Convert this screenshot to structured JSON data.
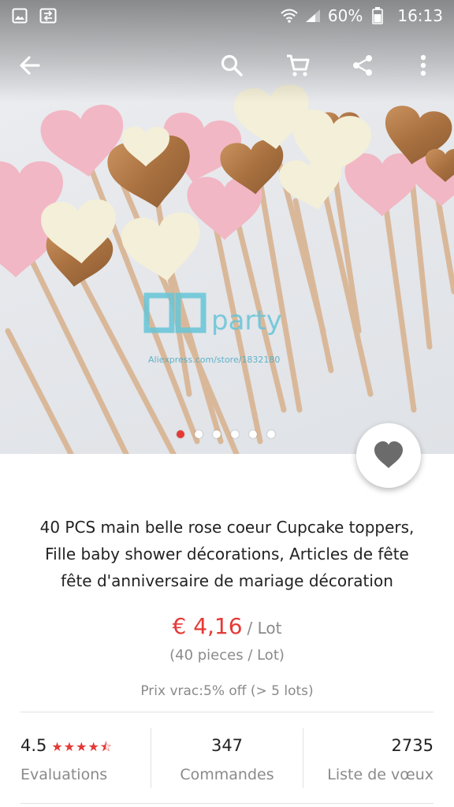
{
  "status_bar": {
    "battery_text": "60%",
    "time": "16:13"
  },
  "icons": {
    "back": "arrow-left-icon",
    "search": "search-icon",
    "cart": "cart-icon",
    "share": "share-icon",
    "more": "more-vertical-icon",
    "favorite": "heart-icon"
  },
  "product_image": {
    "watermark_brand": "party",
    "watermark_url": "Aliexpress.com/store/1832180",
    "slide_count": 6,
    "active_slide": 1
  },
  "product": {
    "title_lines": [
      "40 PCS main belle rose coeur Cupcake toppers,",
      "Fille baby shower décorations, Articles de fête",
      "fête d'anniversaire de mariage décoration"
    ],
    "price": "€ 4,16",
    "price_unit": "/ Lot",
    "pieces": "(40 pieces / Lot)",
    "bulk_price": "Prix vrac:5% off (> 5 lots)"
  },
  "stats": {
    "rating": "4.5",
    "rating_value": 4.5,
    "rating_label": "Evaluations",
    "orders": "347",
    "orders_label": "Commandes",
    "wishlist": "2735",
    "wishlist_label": "Liste de vœux"
  },
  "colors": {
    "accent": "#e53935",
    "muted_text": "#8a8a8a"
  }
}
